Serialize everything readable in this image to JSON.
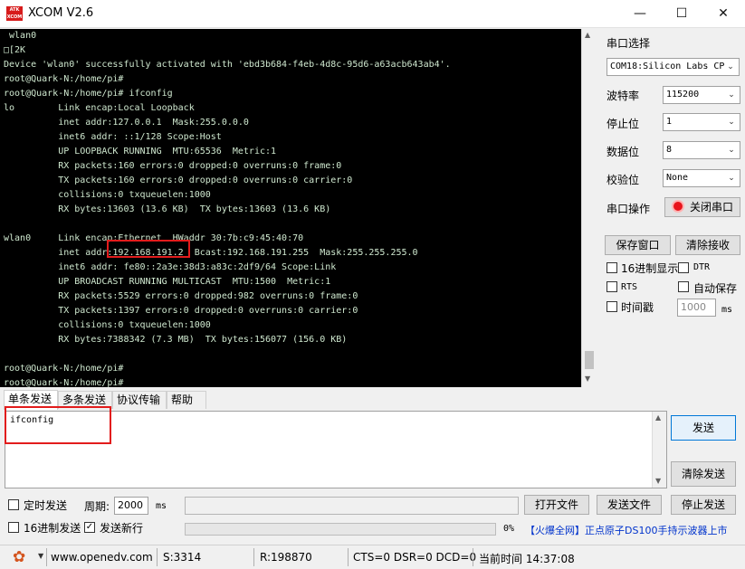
{
  "window": {
    "logo_text": "ATK\nXCOM",
    "title": "XCOM V2.6",
    "minimize": "—",
    "maximize": "☐",
    "close": "✕"
  },
  "terminal": {
    "lines": [
      " wlan0",
      "□[2K",
      "Device 'wlan0' successfully activated with 'ebd3b684-f4eb-4d8c-95d6-a63acb643ab4'.",
      "root@Quark-N:/home/pi#",
      "root@Quark-N:/home/pi# ifconfig",
      "lo        Link encap:Local Loopback",
      "          inet addr:127.0.0.1  Mask:255.0.0.0",
      "          inet6 addr: ::1/128 Scope:Host",
      "          UP LOOPBACK RUNNING  MTU:65536  Metric:1",
      "          RX packets:160 errors:0 dropped:0 overruns:0 frame:0",
      "          TX packets:160 errors:0 dropped:0 overruns:0 carrier:0",
      "          collisions:0 txqueuelen:1000",
      "          RX bytes:13603 (13.6 KB)  TX bytes:13603 (13.6 KB)",
      "",
      "wlan0     Link encap:Ethernet  HWaddr 30:7b:c9:45:40:70",
      "          inet addr:192.168.191.2  Bcast:192.168.191.255  Mask:255.255.255.0",
      "          inet6 addr: fe80::2a3e:38d3:a83c:2df9/64 Scope:Link",
      "          UP BROADCAST RUNNING MULTICAST  MTU:1500  Metric:1",
      "          RX packets:5529 errors:0 dropped:982 overruns:0 frame:0",
      "          TX packets:1397 errors:0 dropped:0 overruns:0 carrier:0",
      "          collisions:0 txqueuelen:1000",
      "          RX bytes:7388342 (7.3 MB)  TX bytes:156077 (156.0 KB)",
      "",
      "root@Quark-N:/home/pi#",
      "root@Quark-N:/home/pi#"
    ]
  },
  "side": {
    "port_select_label": "串口选择",
    "port_value": "COM18:Silicon Labs CP",
    "baud_label": "波特率",
    "baud_value": "115200",
    "stop_label": "停止位",
    "stop_value": "1",
    "data_label": "数据位",
    "data_value": "8",
    "parity_label": "校验位",
    "parity_value": "None",
    "port_op_label": "串口操作",
    "close_port_button": "关闭串口",
    "save_window_button": "保存窗口",
    "clear_receive_button": "清除接收",
    "hex_display_label": "16进制显示",
    "dtr_label": "DTR",
    "rts_label": "RTS",
    "auto_save_label": "自动保存",
    "timestamp_label": "时间戳",
    "timestamp_value": "1000",
    "ms_label": "ms"
  },
  "tabs": [
    "单条发送",
    "多条发送",
    "协议传输",
    "帮助"
  ],
  "send": {
    "text": "ifconfig",
    "send_button": "发送",
    "clear_send_button": "清除发送"
  },
  "bottom": {
    "timed_send_label": "定时发送",
    "period_label": "周期:",
    "period_value": "2000",
    "ms_label": "ms",
    "open_file_button": "打开文件",
    "send_file_button": "发送文件",
    "stop_send_button": "停止发送",
    "hex_send_label": "16进制发送",
    "newline_label": "发送新行",
    "progress_percent": "0%",
    "ad_text": "【火爆全网】正点原子DS100手持示波器上市"
  },
  "status": {
    "url": "www.openedv.com",
    "sent": "S:3314",
    "received": "R:198870",
    "signals": "CTS=0 DSR=0 DCD=0",
    "time": "当前时间 14:37:08"
  }
}
